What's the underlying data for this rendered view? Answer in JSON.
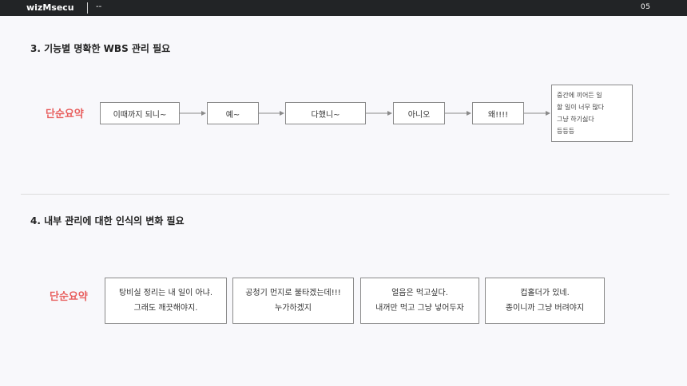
{
  "topbar": {
    "brand": "wizMsecu",
    "title": "--",
    "page": "05"
  },
  "section3": {
    "heading": "3.  기능별 명확한 WBS 관리 필요",
    "label": "단순요약",
    "flow": [
      "이때까지 되니~",
      "예~",
      "다했니~",
      "아니오",
      "왜!!!!"
    ],
    "note_lines": [
      "중간에 끼어든 일",
      "할 일이 너무 많다",
      "그냥 하기싫다",
      "등등등"
    ]
  },
  "section4": {
    "heading": "4.  내부 관리에 대한 인식의 변화 필요",
    "label": "단순요약",
    "cards": [
      {
        "line1": "탕비실 정리는 내 일이 아냐.",
        "line2": "그래도 깨끗해야지."
      },
      {
        "line1": "공청기 먼지로 불타겠는데!!!",
        "line2": "누가하겠지"
      },
      {
        "line1": "얼음은 먹고싶다.",
        "line2": "내꺼만 먹고 그냥 넣어두자"
      },
      {
        "line1": "컵홀더가 있네.",
        "line2": "종이니까 그냥 버려야지"
      }
    ]
  },
  "colors": {
    "accent": "#e8605f",
    "topbar": "#222426",
    "background": "#f8f8fb"
  },
  "icons": {
    "flow_arrow": "arrow-right-icon"
  }
}
